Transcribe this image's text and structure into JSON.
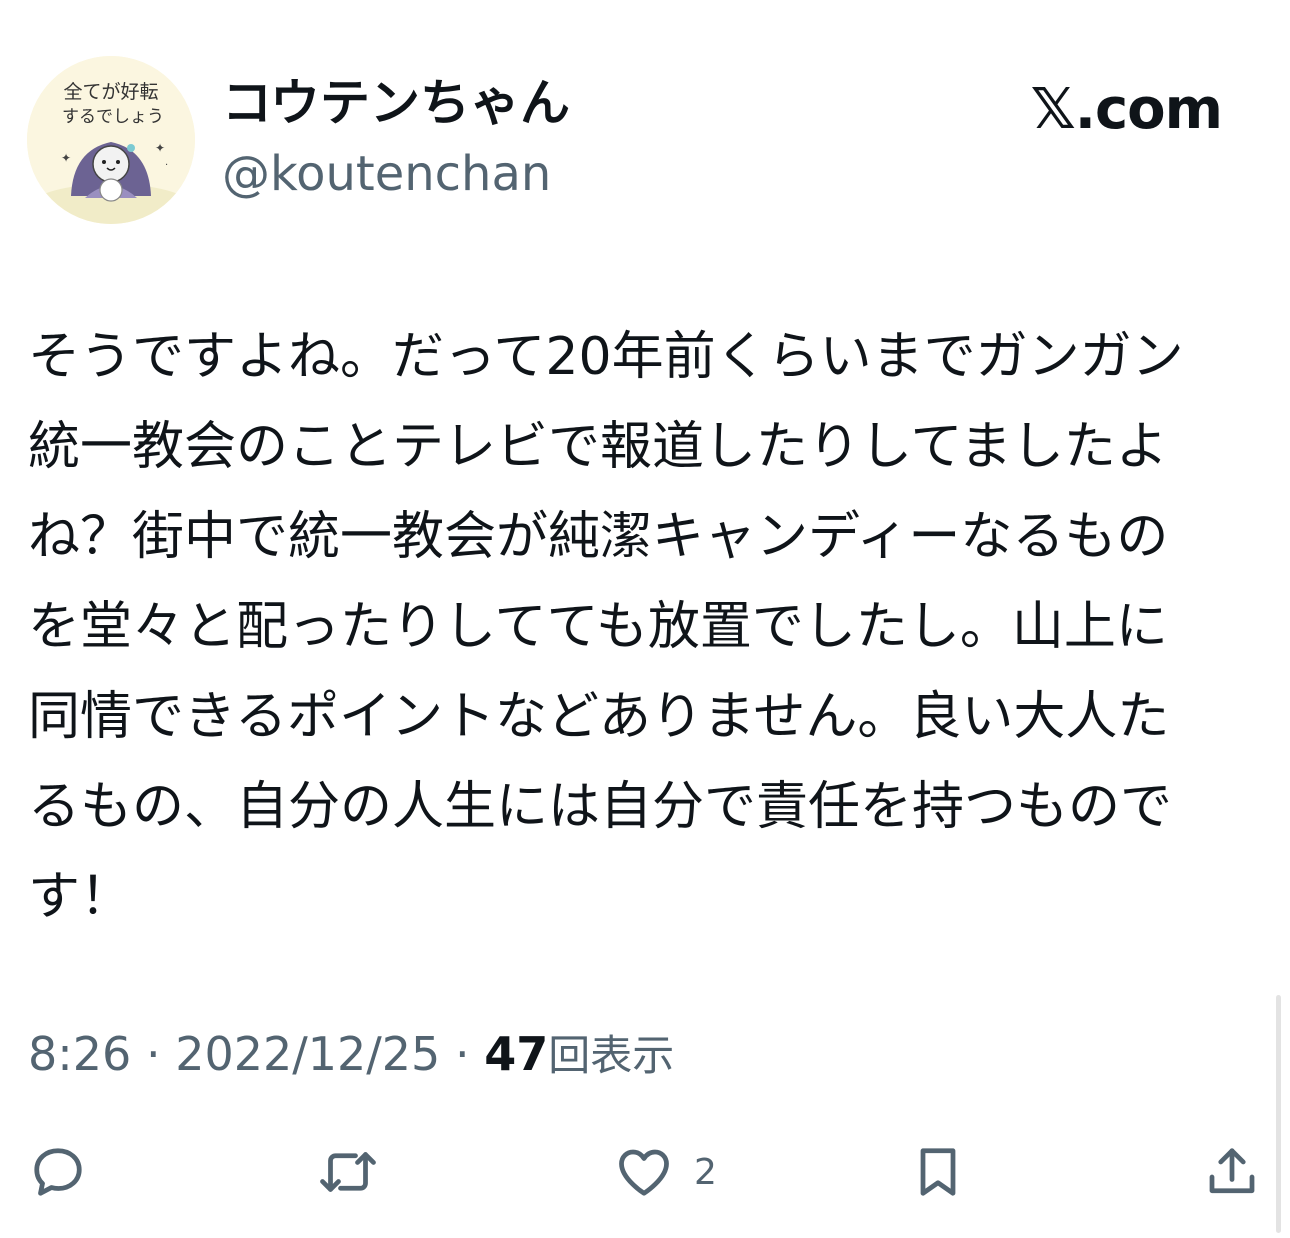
{
  "author": {
    "display_name": "コウテンちゃん",
    "handle": "@koutenchan",
    "avatar_text_line1": "全てが好転",
    "avatar_text_line2": "するでしょう"
  },
  "brand": "𝕏.com",
  "tweet": {
    "text": "そうですよね。だって20年前くらいまでガンガン統一教会のことテレビで報道したりしてましたよね？街中で統一教会が純潔キャンディーなるものを堂々と配ったりしてても放置でしたし。山上に同情できるポイントなどありません。良い大人たるもの、自分の人生には自分で責任を持つものです！"
  },
  "meta": {
    "time": "8:26",
    "separator": "·",
    "date": "2022/12/25",
    "views_count": "47",
    "views_label": "回表示"
  },
  "actions": {
    "reply_icon": "reply-icon",
    "retweet_icon": "retweet-icon",
    "like_icon": "heart-icon",
    "like_count": "2",
    "bookmark_icon": "bookmark-icon",
    "share_icon": "share-icon"
  },
  "colors": {
    "text": "#0f1419",
    "secondary": "#536471",
    "avatar_bg": "#fbf6e0",
    "avatar_pink": "#e57fa6"
  }
}
